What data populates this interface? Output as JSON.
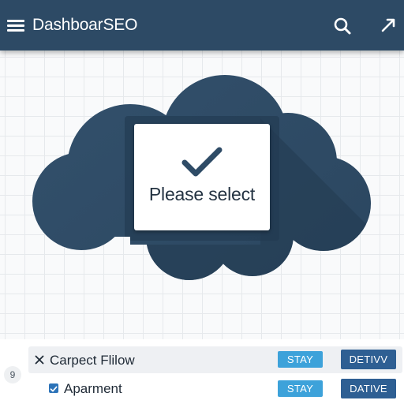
{
  "header": {
    "title": "DashboarSEO",
    "menu_icon": "hamburger-menu-icon",
    "search_icon": "search-icon",
    "expand_icon": "expand-arrow-icon"
  },
  "dialog": {
    "message": "Please select",
    "icon": "checkmark-icon"
  },
  "list": {
    "badge": "9",
    "rows": [
      {
        "label": "Carpect Flilow",
        "leading_icon": "close-icon",
        "stay_label": "STAY",
        "action_label": "DETIVV"
      },
      {
        "label": "Aparment",
        "leading_icon": "checkbox-checked-icon",
        "stay_label": "STAY",
        "action_label": "DATIVE"
      }
    ]
  },
  "colors": {
    "header_bg": "#2d4a65",
    "cloud": "#2e4b66",
    "stay_button": "#3da2da",
    "action_button": "#2e5f93",
    "checkbox": "#2c73b8"
  }
}
